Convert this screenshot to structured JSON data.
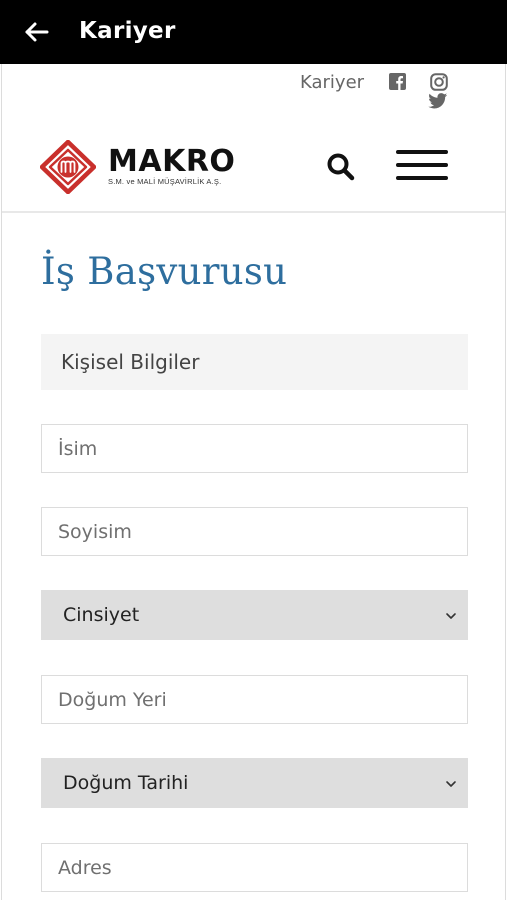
{
  "appbar": {
    "title": "Kariyer"
  },
  "topbar": {
    "link_label": "Kariyer"
  },
  "logo": {
    "name": "MAKRO",
    "subtitle": "S.M. ve MALİ MÜŞAVİRLİK A.Ş."
  },
  "page": {
    "title": "İş Başvurusu"
  },
  "section": {
    "label": "Kişisel Bilgiler"
  },
  "form": {
    "first_name_placeholder": "İsim",
    "last_name_placeholder": "Soyisim",
    "gender_value": "Cinsiyet",
    "birth_place_placeholder": "Doğum Yeri",
    "birth_date_value": "Doğum Tarihi",
    "address_placeholder": "Adres"
  },
  "colors": {
    "accent": "#2e6e9e",
    "logo_red": "#c9302c",
    "appbar": "#000000"
  }
}
